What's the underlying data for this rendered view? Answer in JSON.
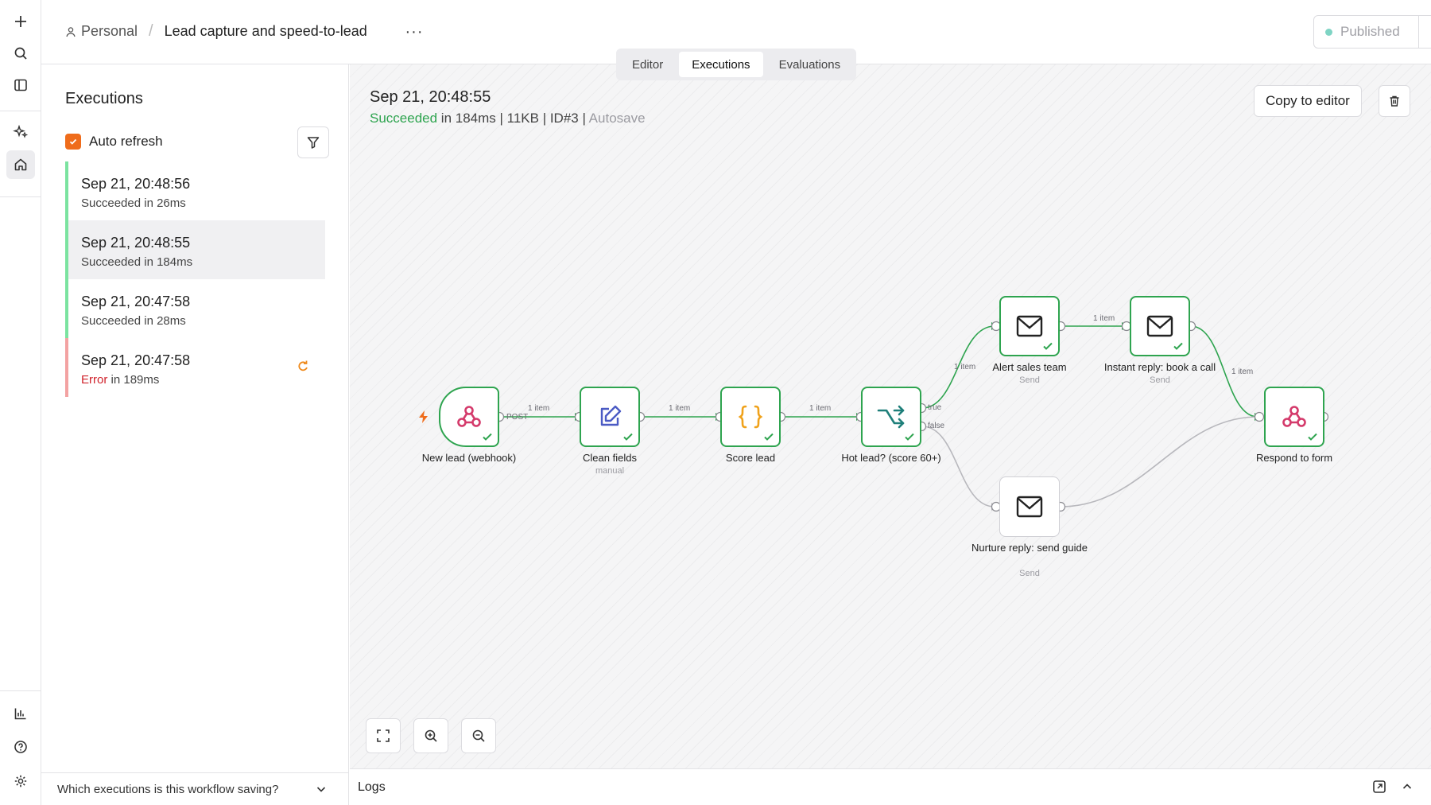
{
  "header": {
    "project": "Personal",
    "workflow_name": "Lead capture and speed-to-lead",
    "more": "···",
    "tabs": [
      {
        "label": "Editor"
      },
      {
        "label": "Executions"
      },
      {
        "label": "Evaluations"
      }
    ],
    "publish_label": "Published"
  },
  "sidebar": {
    "title": "Executions",
    "auto_refresh_label": "Auto refresh",
    "items": [
      {
        "date": "Sep 21, 20:48:56",
        "status_word": "Succeeded",
        "status_rest": " in 26ms"
      },
      {
        "date": "Sep 21, 20:48:55",
        "status_word": "Succeeded",
        "status_rest": " in 184ms"
      },
      {
        "date": "Sep 21, 20:47:58",
        "status_word": "Succeeded",
        "status_rest": " in 28ms"
      },
      {
        "date": "Sep 21, 20:47:58",
        "status_word": "Error",
        "status_rest": " in 189ms"
      }
    ],
    "save_question": "Which executions is this workflow saving?"
  },
  "execution": {
    "date": "Sep 21, 20:48:55",
    "status": "Succeeded",
    "meta": " in 184ms | 11KB | ID#3 | ",
    "autosave": "Autosave",
    "copy_label": "Copy to editor"
  },
  "nodes": [
    {
      "label": "New lead (webhook)",
      "sub": "",
      "icon": "webhook-icon"
    },
    {
      "label": "Clean fields",
      "sub": "manual",
      "icon": "edit-icon"
    },
    {
      "label": "Score lead",
      "sub": "",
      "icon": "code-braces-icon"
    },
    {
      "label": "Hot lead? (score 60+)",
      "sub": "",
      "icon": "if-branch-icon"
    },
    {
      "label": "Alert sales team",
      "sub": "Send",
      "icon": "mail-icon"
    },
    {
      "label": "Instant reply: book a call",
      "sub": "Send",
      "icon": "mail-icon"
    },
    {
      "label": "Nurture reply: send guide",
      "sub": "Send",
      "icon": "mail-icon"
    },
    {
      "label": "Respond to form",
      "sub": "",
      "icon": "webhook-icon"
    }
  ],
  "edges": {
    "post": "POST",
    "item": "1 item",
    "true": "true",
    "false": "false"
  },
  "logs": {
    "title": "Logs"
  },
  "colors": {
    "success": "#2ea44f",
    "error": "#d0222b",
    "accent": "#ef6c1b",
    "node_border": "#2ea44f"
  }
}
